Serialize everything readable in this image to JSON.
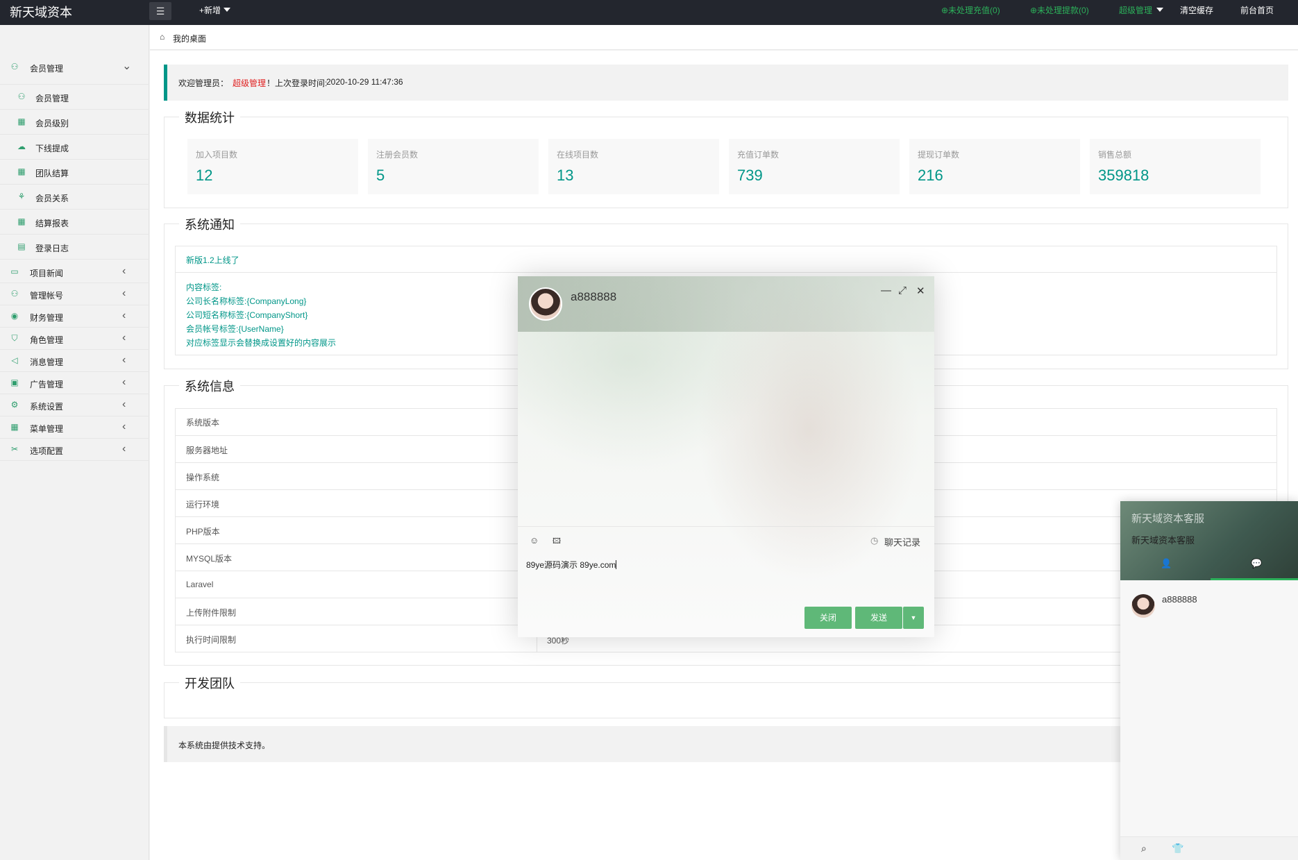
{
  "topbar": {
    "brand": "新天域资本",
    "menu_icon": "☰",
    "add_new": "+新增",
    "unprocessed_recharge": "⊕未处理充值(0)",
    "unprocessed_withdraw": "⊕未处理提款(0)",
    "super_admin": "超级管理",
    "clear_cache": "清空缓存",
    "frontend_home": "前台首页"
  },
  "sidebar": {
    "items": [
      {
        "label": "会员管理",
        "icon": "user-icon",
        "expanded": true
      },
      {
        "label": "会员管理",
        "icon": "user-icon",
        "sub": true
      },
      {
        "label": "会员级别",
        "icon": "grid-icon",
        "sub": true
      },
      {
        "label": "下线提成",
        "icon": "cloud-icon",
        "sub": true
      },
      {
        "label": "团队结算",
        "icon": "grid-icon",
        "sub": true
      },
      {
        "label": "会员关系",
        "icon": "tree-icon",
        "sub": true
      },
      {
        "label": "结算报表",
        "icon": "grid-icon",
        "sub": true
      },
      {
        "label": "登录日志",
        "icon": "calendar-icon",
        "sub": true
      },
      {
        "label": "项目新闻",
        "icon": "news-icon"
      },
      {
        "label": "管理帐号",
        "icon": "users-icon"
      },
      {
        "label": "财务管理",
        "icon": "finance-icon"
      },
      {
        "label": "角色管理",
        "icon": "shield-icon"
      },
      {
        "label": "消息管理",
        "icon": "speaker-icon"
      },
      {
        "label": "广告管理",
        "icon": "ad-icon"
      },
      {
        "label": "系统设置",
        "icon": "gear-icon"
      },
      {
        "label": "菜单管理",
        "icon": "menu-grid-icon"
      },
      {
        "label": "选项配置",
        "icon": "tools-icon"
      }
    ]
  },
  "breadcrumb": {
    "home_icon": "⌂",
    "label": "我的桌面"
  },
  "welcome": {
    "prefix": "欢迎管理员：",
    "role": "超级管理",
    "middle": "！上次登录时间:",
    "time": "2020-10-29 11:47:36"
  },
  "stats": {
    "title": "数据统计",
    "items": [
      {
        "label": "加入项目数",
        "value": "12"
      },
      {
        "label": "注册会员数",
        "value": "5"
      },
      {
        "label": "在线项目数",
        "value": "13"
      },
      {
        "label": "充值订单数",
        "value": "739"
      },
      {
        "label": "提现订单数",
        "value": "216"
      },
      {
        "label": "销售总额",
        "value": "359818"
      }
    ]
  },
  "notice": {
    "title": "系统通知",
    "headline": "新版1.2上线了",
    "lines": [
      "内容标签:",
      "公司长名称标签:{CompanyLong}",
      "公司短名称标签:{CompanyShort}",
      "会员帐号标签:{UserName}",
      "对应标签显示会替换成设置好的内容展示"
    ]
  },
  "sysinfo": {
    "title": "系统信息",
    "rows": [
      "系统版本",
      "服务器地址",
      "操作系统",
      "运行环境",
      "PHP版本",
      "MYSQL版本",
      "Laravel",
      "上传附件限制",
      "执行时间限制"
    ],
    "partial_value": "300秒"
  },
  "team": {
    "title": "开发团队"
  },
  "footer": {
    "text": "本系统由提供技术支持。"
  },
  "chat": {
    "contact": "a888888",
    "minimize": "—",
    "maximize": "⤢",
    "close_x": "✕",
    "emoji_icon": "☺",
    "image_icon": "🖾",
    "history_icon": "◷",
    "history": "聊天记录",
    "input_value": "89ye源码演示 89ye.com",
    "close_btn": "关闭",
    "send_btn": "发送",
    "send_more": "▼"
  },
  "cs_panel": {
    "title": "新天域资本客服",
    "subtitle": "新天域资本客服",
    "tab_contacts_icon": "👤",
    "tab_chat_icon": "💬",
    "contact_name": "a888888",
    "search_icon": "⌕",
    "skin_icon": "👕"
  }
}
